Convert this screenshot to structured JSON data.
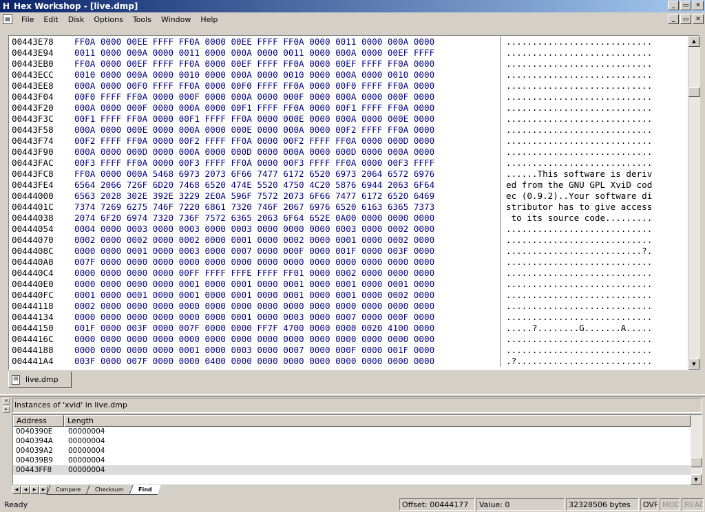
{
  "window": {
    "title": "Hex Workshop - [live.dmp]",
    "app_icon": "H"
  },
  "menu": [
    "File",
    "Edit",
    "Disk",
    "Options",
    "Tools",
    "Window",
    "Help"
  ],
  "hex_view": {
    "rows": [
      {
        "addr": "00443E78",
        "hex": "FF0A 0000 00EE FFFF FF0A 0000 00EE FFFF FF0A 0000 0011 0000 000A 0000",
        "ascii": "............................"
      },
      {
        "addr": "00443E94",
        "hex": "0011 0000 000A 0000 0011 0000 000A 0000 0011 0000 000A 0000 00EF FFFF",
        "ascii": "............................"
      },
      {
        "addr": "00443EB0",
        "hex": "FF0A 0000 00EF FFFF FF0A 0000 00EF FFFF FF0A 0000 00EF FFFF FF0A 0000",
        "ascii": "............................"
      },
      {
        "addr": "00443ECC",
        "hex": "0010 0000 000A 0000 0010 0000 000A 0000 0010 0000 000A 0000 0010 0000",
        "ascii": "............................"
      },
      {
        "addr": "00443EE8",
        "hex": "000A 0000 00F0 FFFF FF0A 0000 00F0 FFFF FF0A 0000 00F0 FFFF FF0A 0000",
        "ascii": "............................"
      },
      {
        "addr": "00443F04",
        "hex": "00F0 FFFF FF0A 0000 000F 0000 000A 0000 000F 0000 000A 0000 000F 0000",
        "ascii": "............................"
      },
      {
        "addr": "00443F20",
        "hex": "000A 0000 000F 0000 000A 0000 00F1 FFFF FF0A 0000 00F1 FFFF FF0A 0000",
        "ascii": "............................"
      },
      {
        "addr": "00443F3C",
        "hex": "00F1 FFFF FF0A 0000 00F1 FFFF FF0A 0000 000E 0000 000A 0000 000E 0000",
        "ascii": "............................"
      },
      {
        "addr": "00443F58",
        "hex": "000A 0000 000E 0000 000A 0000 000E 0000 000A 0000 00F2 FFFF FF0A 0000",
        "ascii": "............................"
      },
      {
        "addr": "00443F74",
        "hex": "00F2 FFFF FF0A 0000 00F2 FFFF FF0A 0000 00F2 FFFF FF0A 0000 000D 0000",
        "ascii": "............................"
      },
      {
        "addr": "00443F90",
        "hex": "000A 0000 000D 0000 000A 0000 000D 0000 000A 0000 000D 0000 000A 0000",
        "ascii": "............................"
      },
      {
        "addr": "00443FAC",
        "hex": "00F3 FFFF FF0A 0000 00F3 FFFF FF0A 0000 00F3 FFFF FF0A 0000 00F3 FFFF",
        "ascii": "............................"
      },
      {
        "addr": "00443FC8",
        "hex": "FF0A 0000 000A 5468 6973 2073 6F66 7477 6172 6520 6973 2064 6572 6976",
        "ascii": "......This software is deriv"
      },
      {
        "addr": "00443FE4",
        "hex": "6564 2066 726F 6D20 7468 6520 474E 5520 4750 4C20 5876 6944 2063 6F64",
        "ascii": "ed from the GNU GPL XviD cod"
      },
      {
        "addr": "00444000",
        "hex": "6563 2028 302E 392E 3229 2E0A 596F 7572 2073 6F66 7477 6172 6520 6469",
        "ascii": "ec (0.9.2)..Your software di"
      },
      {
        "addr": "0044401C",
        "hex": "7374 7269 6275 746F 7220 6861 7320 746F 2067 6976 6520 6163 6365 7373",
        "ascii": "stributor has to give access"
      },
      {
        "addr": "00444038",
        "hex": "2074 6F20 6974 7320 736F 7572 6365 2063 6F64 652E 0A00 0000 0000 0000",
        "ascii": " to its source code........."
      },
      {
        "addr": "00444054",
        "hex": "0004 0000 0003 0000 0003 0000 0003 0000 0000 0000 0003 0000 0002 0000",
        "ascii": "............................"
      },
      {
        "addr": "00444070",
        "hex": "0002 0000 0002 0000 0002 0000 0001 0000 0002 0000 0001 0000 0002 0000",
        "ascii": "............................"
      },
      {
        "addr": "0044408C",
        "hex": "0000 0000 0001 0000 0003 0000 0007 0000 000F 0000 001F 0000 003F 0000",
        "ascii": "..........................?."
      },
      {
        "addr": "004440A8",
        "hex": "007F 0000 0000 0000 0000 0000 0000 0000 0000 0000 0000 0000 0000 0000",
        "ascii": "............................"
      },
      {
        "addr": "004440C4",
        "hex": "0000 0000 0000 0000 00FF FFFF FFFE FFFF FF01 0000 0002 0000 0000 0000",
        "ascii": "............................"
      },
      {
        "addr": "004440E0",
        "hex": "0000 0000 0000 0000 0001 0000 0001 0000 0001 0000 0001 0000 0001 0000",
        "ascii": "............................"
      },
      {
        "addr": "004440FC",
        "hex": "0001 0000 0001 0000 0001 0000 0001 0000 0001 0000 0001 0000 0002 0000",
        "ascii": "............................"
      },
      {
        "addr": "00444118",
        "hex": "0002 0000 0000 0000 0000 0000 0000 0000 0000 0000 0000 0000 0000 0000",
        "ascii": "............................"
      },
      {
        "addr": "00444134",
        "hex": "0000 0000 0000 0000 0000 0000 0001 0000 0003 0000 0007 0000 000F 0000",
        "ascii": "............................"
      },
      {
        "addr": "00444150",
        "hex": "001F 0000 003F 0000 007F 0000 0000 FF7F 4700 0000 0000 0020 4100 0000",
        "ascii": ".....?........G.......A....."
      },
      {
        "addr": "0044416C",
        "hex": "0000 0000 0000 0000 0000 0000 0000 0000 0000 0000 0000 0000 0000 0000",
        "ascii": "............................"
      },
      {
        "addr": "00444188",
        "hex": "0000 0000 0000 0000 0001 0000 0003 0000 0007 0000 000F 0000 001F 0000",
        "ascii": "............................"
      },
      {
        "addr": "004441A4",
        "hex": "003F 0000 007F 0000 0000 0400 0000 0000 0000 0000 0000 0000 0000 0000",
        "ascii": ".?.........................."
      }
    ]
  },
  "doc_tab": {
    "label": "live.dmp"
  },
  "find_panel": {
    "caption": "Instances of 'xvid' in live.dmp",
    "columns": [
      "Address",
      "Length"
    ],
    "results": [
      {
        "address": "0040390E",
        "length": "00000004"
      },
      {
        "address": "0040394A",
        "length": "00000004"
      },
      {
        "address": "004039A2",
        "length": "00000004"
      },
      {
        "address": "004039B9",
        "length": "00000004"
      },
      {
        "address": "00443FF8",
        "length": "00000004"
      }
    ],
    "tabs": [
      "Compare",
      "Checksum",
      "Find"
    ]
  },
  "status": {
    "message": "Ready",
    "offset": "Offset: 00444177",
    "value": "Value: 0",
    "size": "32328506 bytes",
    "mode_ovr": "OVR",
    "mode_mod": "MOD",
    "mode_read": "READ"
  }
}
